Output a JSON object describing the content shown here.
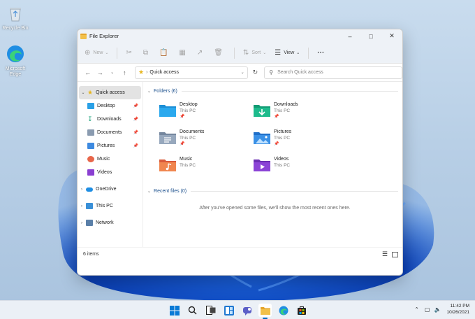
{
  "desktop": {
    "recycle_bin": "Recycle Bin",
    "edge": "Microsoft Edge"
  },
  "window": {
    "title": "File Explorer",
    "toolbar": {
      "new": "New",
      "sort": "Sort",
      "view": "View",
      "more": "···"
    },
    "address": {
      "location": "Quick access",
      "search_placeholder": "Search Quick access"
    },
    "sidebar": {
      "quick_access": "Quick access",
      "items": [
        {
          "label": "Desktop",
          "pinned": true
        },
        {
          "label": "Downloads",
          "pinned": true
        },
        {
          "label": "Documents",
          "pinned": true
        },
        {
          "label": "Pictures",
          "pinned": true
        },
        {
          "label": "Music",
          "pinned": false
        },
        {
          "label": "Videos",
          "pinned": false
        }
      ],
      "onedrive": "OneDrive",
      "this_pc": "This PC",
      "network": "Network"
    },
    "content": {
      "folders_header": "Folders (6)",
      "folders": [
        {
          "name": "Desktop",
          "location": "This PC",
          "pinned": true
        },
        {
          "name": "Downloads",
          "location": "This PC",
          "pinned": true
        },
        {
          "name": "Documents",
          "location": "This PC",
          "pinned": true
        },
        {
          "name": "Pictures",
          "location": "This PC",
          "pinned": true
        },
        {
          "name": "Music",
          "location": "This PC",
          "pinned": false
        },
        {
          "name": "Videos",
          "location": "This PC",
          "pinned": false
        }
      ],
      "recent_header": "Recent files (0)",
      "recent_empty": "After you've opened some files, we'll show the most recent ones here."
    },
    "status": {
      "items": "6 items"
    }
  },
  "taskbar": {
    "time": "11:42 PM",
    "date": "10/26/2021"
  },
  "colors": {
    "accent": "#0067c0",
    "folder_yellow": "#f2c04a",
    "quick_access_star": "#e7b51c"
  }
}
